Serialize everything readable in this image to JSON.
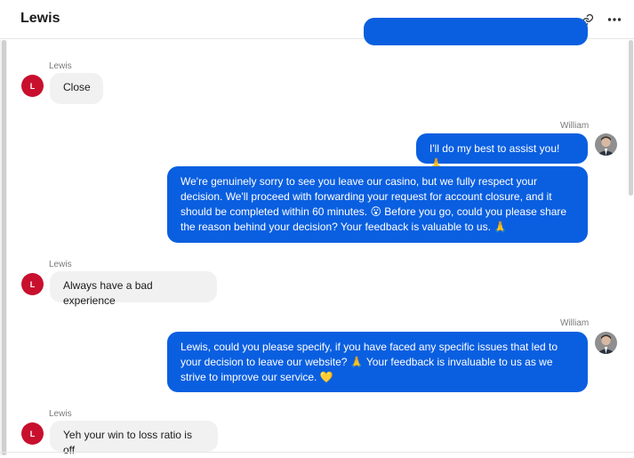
{
  "header": {
    "title": "Lewis",
    "icons": [
      "link-icon",
      "more-icon"
    ]
  },
  "avatars": {
    "customer_initial": "L"
  },
  "messages": [
    {
      "sender": "Lewis",
      "text": "Close"
    },
    {
      "sender": "William",
      "text": "I'll do my best to assist you! 🙏"
    },
    {
      "text": "We're genuinely sorry to see you leave our casino, but we fully respect your decision. We'll proceed with forwarding your request for account closure, and it should be completed within 60 minutes. 😮 Before you go, could you please share the reason behind your decision? Your feedback is valuable to us. 🙏"
    },
    {
      "sender": "Lewis",
      "text": "Always have a bad experience"
    },
    {
      "sender": "William",
      "text": "Lewis, could you please specify, if you have faced any specific issues that led to your decision to leave our website? 🙏 Your feedback is invaluable to us as we strive to improve our service. 💛"
    },
    {
      "sender": "Lewis",
      "text": "Yeh your win to loss ratio is off"
    }
  ],
  "colors": {
    "agent_bubble": "#0a5fe0",
    "customer_bubble": "#f1f1f1",
    "customer_avatar": "#c8102e"
  }
}
